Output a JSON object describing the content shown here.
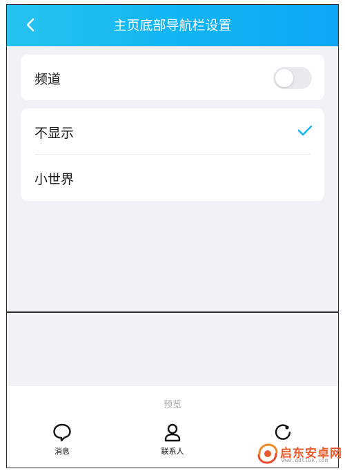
{
  "header": {
    "title": "主页底部导航栏设置",
    "back_icon": "chevron-left-icon"
  },
  "channel": {
    "label": "频道",
    "toggle_on": false
  },
  "options": [
    {
      "label": "不显示",
      "selected": true
    },
    {
      "label": "小世界",
      "selected": false
    }
  ],
  "preview": {
    "label": "预览",
    "tabs": [
      {
        "label": "消息",
        "icon": "chat-bubble-icon"
      },
      {
        "label": "联系人",
        "icon": "person-icon"
      },
      {
        "label": "",
        "icon": "orbit-icon"
      }
    ]
  },
  "watermark": {
    "text": "启东安卓网",
    "sub": "www.qdtlbk.com"
  },
  "colors": {
    "header_start": "#27c3ef",
    "header_end": "#0ea6f5",
    "accent": "#12b7f5",
    "watermark": "#e85a2c"
  }
}
